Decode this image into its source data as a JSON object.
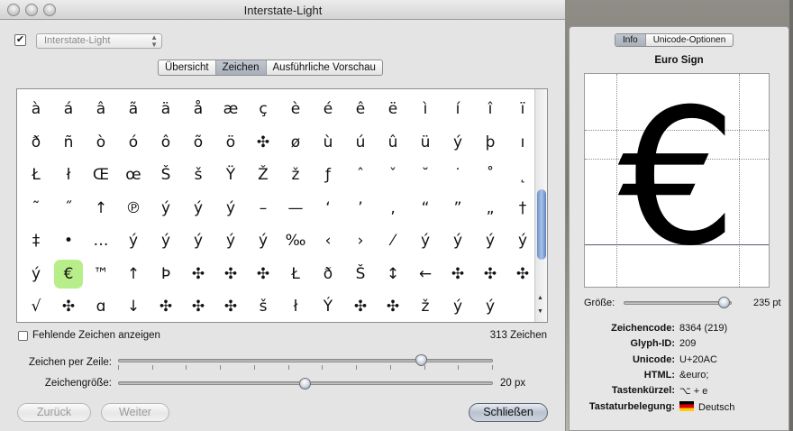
{
  "window": {
    "title": "Interstate-Light"
  },
  "font_selector": {
    "checked": "✔",
    "value": "Interstate-Light",
    "arrows": "▲▼"
  },
  "view_tabs": [
    {
      "label": "Übersicht",
      "selected": false
    },
    {
      "label": "Zeichen",
      "selected": true
    },
    {
      "label": "Ausführliche Vorschau",
      "selected": false
    }
  ],
  "glyph_rows": [
    [
      "à",
      "á",
      "â",
      "ã",
      "ä",
      "å",
      "æ",
      "ç",
      "è",
      "é",
      "ê",
      "ë",
      "ì",
      "í",
      "î",
      "ï"
    ],
    [
      "ð",
      "ñ",
      "ò",
      "ó",
      "ô",
      "õ",
      "ö",
      "✣",
      "ø",
      "ù",
      "ú",
      "û",
      "ü",
      "ý",
      "þ",
      "ı"
    ],
    [
      "Ł",
      "ł",
      "Œ",
      "œ",
      "Š",
      "š",
      "Ÿ",
      "Ž",
      "ž",
      "ƒ",
      "ˆ",
      "ˇ",
      "˘",
      "˙",
      "˚",
      "˛"
    ],
    [
      "˜",
      "˝",
      "↑",
      "℗",
      "ý",
      "ý",
      "ý",
      "–",
      "—",
      "‘",
      "’",
      "‚",
      "“",
      "”",
      "„",
      "†"
    ],
    [
      "‡",
      "•",
      "…",
      "ý",
      "ý",
      "ý",
      "ý",
      "ý",
      "‰",
      "‹",
      "›",
      "⁄",
      "ý",
      "ý",
      "ý",
      "ý"
    ],
    [
      "ý",
      "€",
      "™",
      "↑",
      "Þ",
      "✣",
      "✣",
      "✣",
      "Ł",
      "ð",
      "Š",
      "↕",
      "←",
      "✣",
      "✣",
      "✣"
    ],
    [
      "√",
      "✣",
      "ɑ",
      "↓",
      "✣",
      "✣",
      "✣",
      "š",
      "ł",
      "Ý",
      "✣",
      "✣",
      "ž",
      "ý",
      "ý",
      ""
    ]
  ],
  "selected_glyph": {
    "row": 5,
    "col": 1
  },
  "grid_scroll": {
    "up": "▲",
    "down": "▼",
    "position": 0.52
  },
  "missing_glyphs": {
    "label": "Fehlende Zeichen anzeigen",
    "checked": false
  },
  "glyph_count": "313 Zeichen",
  "per_row_slider": {
    "label": "Zeichen per Zeile:",
    "value": 0.81,
    "ticks": 12
  },
  "size_slider": {
    "label": "Zeichengröße:",
    "value": 0.5,
    "value_text": "20 px"
  },
  "buttons": {
    "back": "Zurück",
    "next": "Weiter",
    "close": "Schließen"
  },
  "info_panel": {
    "tabs": [
      {
        "label": "Info",
        "selected": true
      },
      {
        "label": "Unicode-Optionen",
        "selected": false
      }
    ],
    "glyph_name": "Euro Sign",
    "preview_glyph": "€",
    "size_label": "Größe:",
    "size_value": "235 pt",
    "size_slider_value": 0.93,
    "rows": [
      {
        "key": "Zeichencode:",
        "value": "8364 (219)"
      },
      {
        "key": "Glyph-ID:",
        "value": "209"
      },
      {
        "key": "Unicode:",
        "value": "U+20AC"
      },
      {
        "key": "HTML:",
        "value": "&euro;"
      },
      {
        "key": "Tastenkürzel:",
        "value": "⌥ + e"
      },
      {
        "key": "Tastaturbelegung:",
        "value": "Deutsch",
        "flag": true
      }
    ]
  },
  "colors": {
    "selection": "#b7ee8a",
    "accent": "#6a8fc6"
  }
}
